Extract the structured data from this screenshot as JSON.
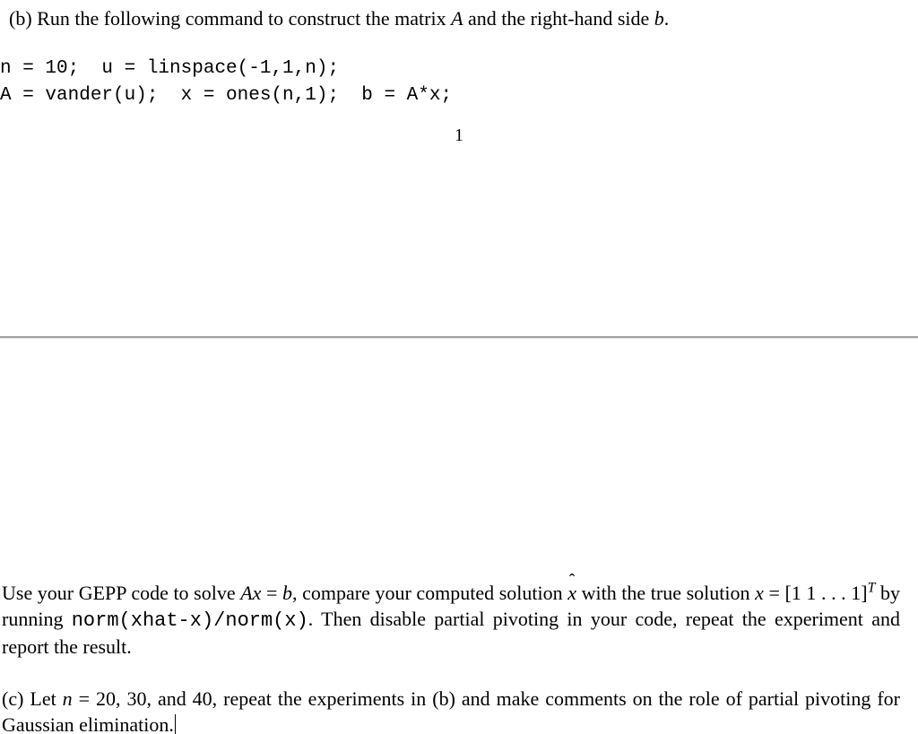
{
  "partB": {
    "label": "(b)",
    "text_before_A": "Run the following command to construct the matrix ",
    "A": "A",
    "text_mid": " and the right-hand side ",
    "b": "b",
    "text_after": "."
  },
  "code": {
    "line1": "n = 10;  u = linspace(-1,1,n);",
    "line2": "A = vander(u);  x = ones(n,1);  b = A*x;"
  },
  "pagenum": "1",
  "lower": {
    "seg1": "Use your GEPP code to solve ",
    "Ax": "Ax",
    "eq1": " = ",
    "b": "b",
    "seg2": ", compare your computed solution ",
    "xhat": "x",
    "seg3": " with the true solution ",
    "x": "x",
    "eq2": " = [1 1 . . . 1]",
    "T": "T",
    "seg4": " by running ",
    "code": "norm(xhat-x)/norm(x)",
    "seg5": ". Then disable partial pivoting in your code, repeat the experiment and report the result."
  },
  "partC": {
    "label": "(c)",
    "seg1": " Let ",
    "n": "n",
    "seg2": " = 20, 30, and 40, repeat the experiments in (b) and make comments on the role of partial pivoting for Gaussian elimination."
  }
}
